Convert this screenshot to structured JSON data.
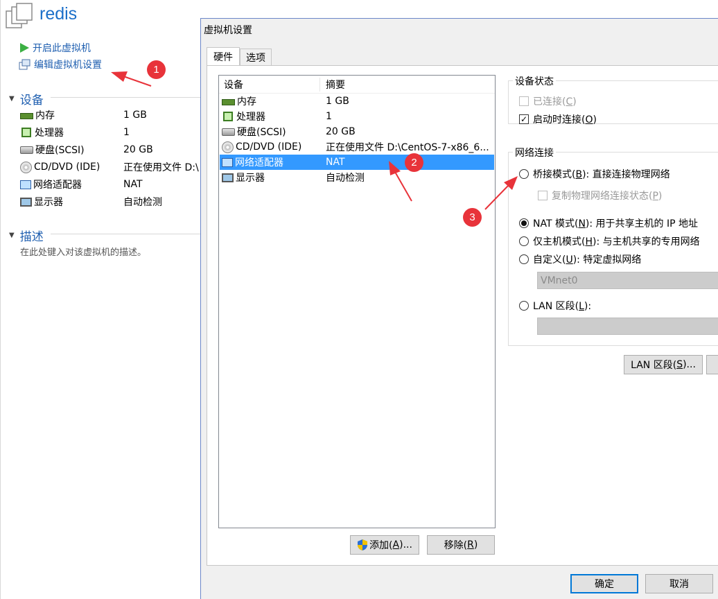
{
  "vm": {
    "name": "redis",
    "icon": "vm-icon"
  },
  "actions": [
    {
      "label": "开启此虚拟机",
      "icon": "play-icon"
    },
    {
      "label": "编辑虚拟机设置",
      "icon": "settings-icon"
    }
  ],
  "summary": {
    "devices_heading": "设备",
    "devices": [
      {
        "name": "内存",
        "value": "1 GB",
        "icon": "memory-icon"
      },
      {
        "name": "处理器",
        "value": "1",
        "icon": "cpu-icon"
      },
      {
        "name": "硬盘(SCSI)",
        "value": "20 GB",
        "icon": "disk-icon"
      },
      {
        "name": "CD/DVD (IDE)",
        "value": "正在使用文件 D:\\",
        "icon": "cd-icon"
      },
      {
        "name": "网络适配器",
        "value": "NAT",
        "icon": "network-icon"
      },
      {
        "name": "显示器",
        "value": "自动检测",
        "icon": "monitor-icon"
      }
    ],
    "description_heading": "描述",
    "description_placeholder": "在此处键入对该虚拟机的描述。"
  },
  "dialog": {
    "title": "虚拟机设置",
    "tabs": [
      "硬件",
      "选项"
    ],
    "list_headers": {
      "device": "设备",
      "summary": "摘要"
    },
    "list_rows": [
      {
        "name": "内存",
        "summary": "1 GB",
        "icon": "memory-icon"
      },
      {
        "name": "处理器",
        "summary": "1",
        "icon": "cpu-icon"
      },
      {
        "name": "硬盘(SCSI)",
        "summary": "20 GB",
        "icon": "disk-icon"
      },
      {
        "name": "CD/DVD (IDE)",
        "summary": "正在使用文件 D:\\CentOS-7-x86_6...",
        "icon": "cd-icon"
      },
      {
        "name": "网络适配器",
        "summary": "NAT",
        "icon": "network-icon",
        "selected": true
      },
      {
        "name": "显示器",
        "summary": "自动检测",
        "icon": "monitor-icon"
      }
    ],
    "add_button": {
      "label": "添加(",
      "key": "A",
      "suffix": ")..."
    },
    "remove_button": {
      "label": "移除(",
      "key": "R",
      "suffix": ")"
    },
    "ok_button": "确定",
    "cancel_button": "取消",
    "device_status": {
      "title": "设备状态",
      "connected": {
        "label": "已连接(",
        "key": "C",
        "suffix": ")",
        "checked": false,
        "enabled": false
      },
      "connect_at_power_on": {
        "label": "启动时连接(",
        "key": "O",
        "suffix": ")",
        "checked": true
      }
    },
    "network": {
      "title": "网络连接",
      "bridged": {
        "label": "桥接模式(",
        "key": "B",
        "suffix": "): 直接连接物理网络"
      },
      "replicate": {
        "label": "复制物理网络连接状态(",
        "key": "P",
        "suffix": ")"
      },
      "nat": {
        "label": "NAT 模式(",
        "key": "N",
        "suffix": "): 用于共享主机的 IP 地址"
      },
      "host_only": {
        "label": "仅主机模式(",
        "key": "H",
        "suffix": "): 与主机共享的专用网络"
      },
      "custom": {
        "label": "自定义(",
        "key": "U",
        "suffix": "): 特定虚拟网络"
      },
      "custom_value": "VMnet0",
      "lan": {
        "label": "LAN 区段(",
        "key": "L",
        "suffix": "):"
      },
      "lan_value": "",
      "selected": "nat"
    },
    "lan_segments_button": {
      "label": "LAN 区段(",
      "key": "S",
      "suffix": ")..."
    }
  },
  "annotations": [
    {
      "number": "1"
    },
    {
      "number": "2"
    },
    {
      "number": "3"
    }
  ],
  "colors": {
    "accent": "#3399ff",
    "link": "#1f5fb0",
    "annotation": "#e8333a",
    "title": "#1b6fc9"
  }
}
